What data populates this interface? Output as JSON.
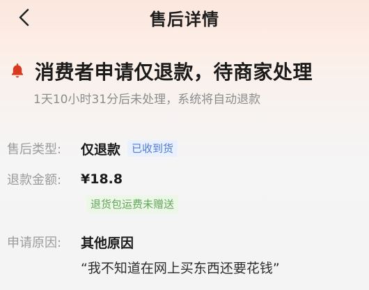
{
  "nav": {
    "title": "售后详情"
  },
  "status": {
    "title": "消费者申请仅退款，待商家处理",
    "subtitle": "1天10小时31分后未处理，系统将自动退款"
  },
  "details": {
    "type": {
      "label": "售后类型:",
      "value": "仅退款",
      "badge": "已收到货"
    },
    "amount": {
      "label": "退款金额:",
      "value": "¥18.8",
      "note": "退货包运费未赠送"
    },
    "reason": {
      "label": "申请原因:",
      "value": "其他原因",
      "detail": "“我不知道在网上买东西还要花钱”"
    }
  },
  "icons": {
    "back": "back-icon",
    "bell": "bell-icon"
  },
  "colors": {
    "bell": "#d93a1f",
    "badge_bg": "#eaf1fe",
    "badge_text": "#4e79d8",
    "note_bg": "#edf7e8",
    "note_text": "#62a65a"
  }
}
